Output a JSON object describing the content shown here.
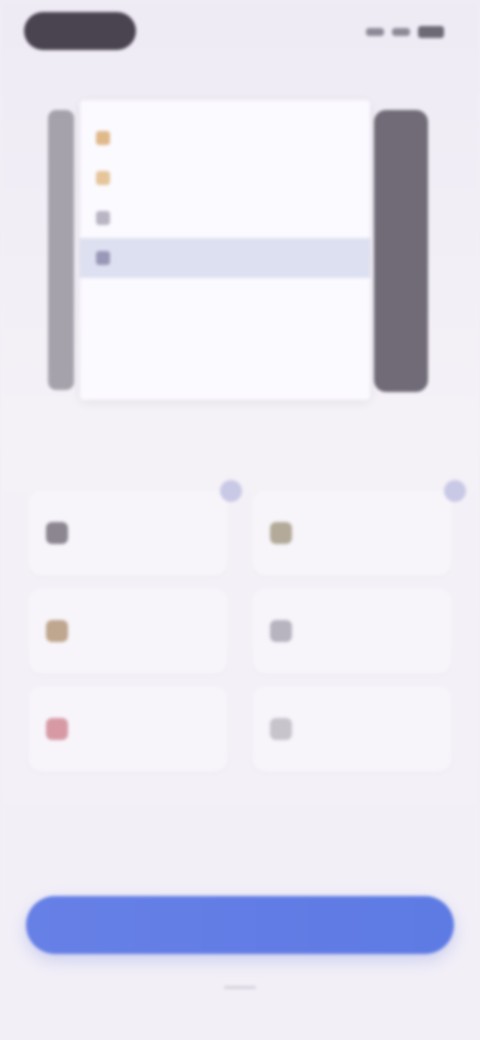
{
  "status_bar": {
    "pill_color": "#4a4450"
  },
  "preview": {
    "rows": [
      {
        "text": "",
        "icon_color": "#e0b98a"
      },
      {
        "text": "",
        "icon_color": "#e6c59a"
      },
      {
        "text": "",
        "icon_color": "#b9b5c3"
      },
      {
        "text": "",
        "icon_color": "#9a98b7"
      }
    ],
    "highlighted_row": 3
  },
  "caption": "",
  "options": {
    "left": [
      {
        "label": "",
        "icon_color": "#8b8690",
        "icon": "folder-icon"
      },
      {
        "label": "",
        "icon_color": "#bfa68f",
        "icon": "image-icon"
      },
      {
        "label": "",
        "icon_color": "#d79aa4",
        "icon": "document-icon"
      }
    ],
    "right": [
      {
        "label": "",
        "icon_color": "#b3aa99",
        "icon": "contact-icon"
      },
      {
        "label": "",
        "icon_color": "#b7b4bf",
        "icon": "message-icon"
      },
      {
        "label": "",
        "icon_color": "#c7c4cc",
        "icon": "more-icon"
      }
    ]
  },
  "primary_button": {
    "label": "",
    "color": "#607ce4"
  }
}
